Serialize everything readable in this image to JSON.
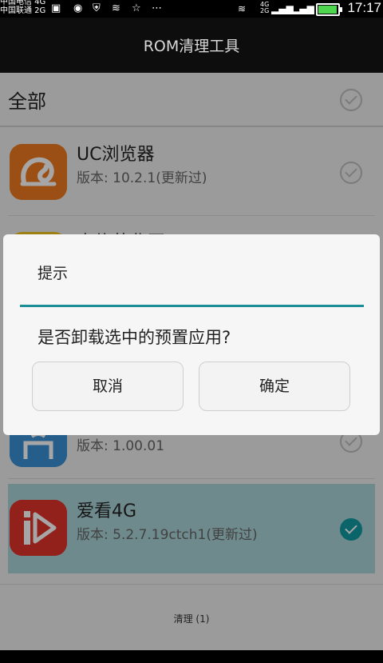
{
  "status_bar": {
    "carrier_line1": "中国电信 4G",
    "carrier_line2": "中国联通 2G",
    "network_badge": "4G",
    "network_badge2": "2G",
    "time": "17:17",
    "battery_level": 0.95
  },
  "header": {
    "title": "ROM清理工具"
  },
  "select_all": {
    "label": "全部",
    "checked": false
  },
  "apps": [
    {
      "name": "UC浏览器",
      "version": "版本: 10.2.1(更新过)",
      "checked": false,
      "icon": "uc-browser-icon"
    },
    {
      "name": "",
      "version": "版本: 1.00.01",
      "checked": false,
      "icon": "wifi-app-icon"
    },
    {
      "name": "爱看4G",
      "version": "版本: 5.2.7.19ctch1(更新过)",
      "checked": true,
      "icon": "aikan-4g-icon"
    }
  ],
  "partial_row_text": "电信营业厅",
  "bottom": {
    "clean_label": "清理 (1)"
  },
  "dialog": {
    "title": "提示",
    "message": "是否卸载选中的预置应用?",
    "cancel_label": "取消",
    "confirm_label": "确定"
  },
  "colors": {
    "accent": "#109aa4",
    "selected_row": "#a9d4d7",
    "dialog_rule": "#1b8e98"
  }
}
